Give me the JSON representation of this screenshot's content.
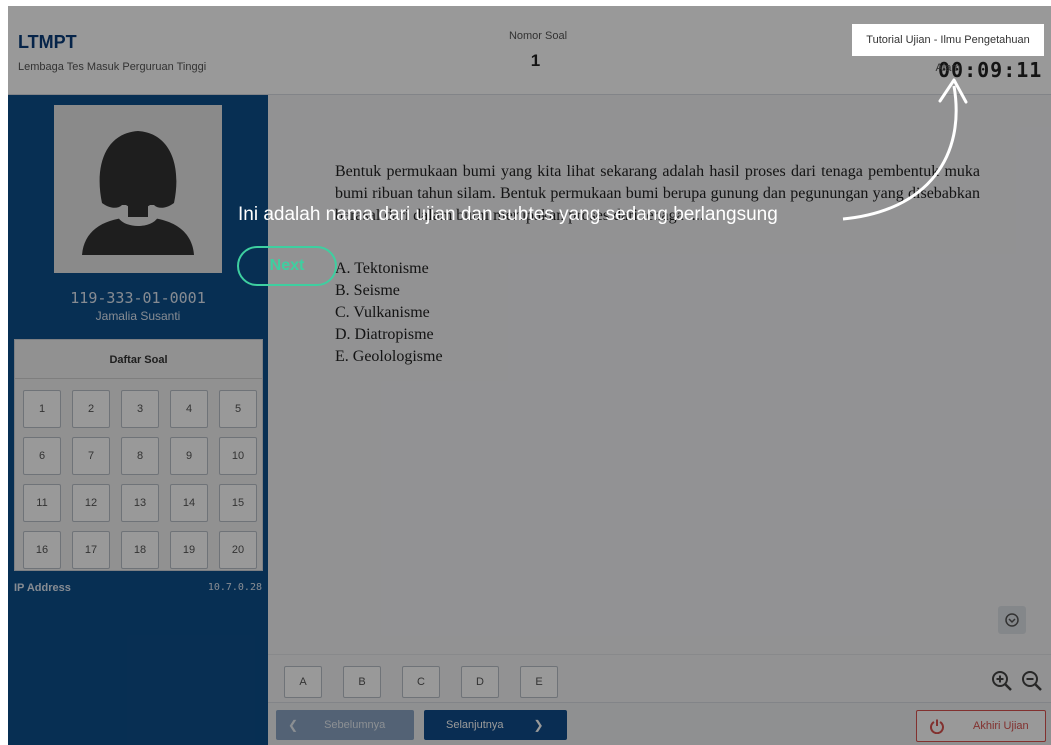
{
  "header": {
    "brand_title": "LTMPT",
    "brand_subtitle": "Lembaga Tes Masuk Perguruan Tinggi",
    "nomor_label": "Nomor Soal",
    "nomor_value": "1",
    "exam_name": "Tutorial Ujian - Ilmu Pengetahuan Alam",
    "timer": "00:09:11"
  },
  "sidebar": {
    "participant_id": "119-333-01-0001",
    "participant_name": "Jamalia Susanti",
    "daftar_title": "Daftar Soal",
    "questions": [
      "1",
      "2",
      "3",
      "4",
      "5",
      "6",
      "7",
      "8",
      "9",
      "10",
      "11",
      "12",
      "13",
      "14",
      "15",
      "16",
      "17",
      "18",
      "19",
      "20"
    ],
    "ip_label": "IP Address",
    "ip_value": "10.7.0.28"
  },
  "question": {
    "text": "Bentuk permukaan bumi yang kita lihat sekarang adalah hasil proses dari tenaga pembentuk muka bumi ribuan tahun silam. Bentuk permukaan bumi berupa gunung dan pegunungan yang disebabkan berasal dari dalam bumi merupakan proses dari tenaga ....",
    "options": [
      "A. Tektonisme",
      "B. Seisme",
      "C. Vulkanisme",
      "D. Diatropisme",
      "E. Geolologisme"
    ]
  },
  "answer_buttons": [
    "A",
    "B",
    "C",
    "D",
    "E"
  ],
  "footer": {
    "prev_label": "Sebelumnya",
    "next_label": "Selanjutnya",
    "end_label": "Akhiri Ujian"
  },
  "tutorial": {
    "text": "Ini adalah nama dari ujian dan subtes yang sedang berlangsung",
    "next_label": "Next"
  },
  "colors": {
    "sidebar": "#0d4f8b",
    "primary": "#0f4c8a",
    "accent_next": "#3ecfa0",
    "danger": "#d9534f"
  }
}
